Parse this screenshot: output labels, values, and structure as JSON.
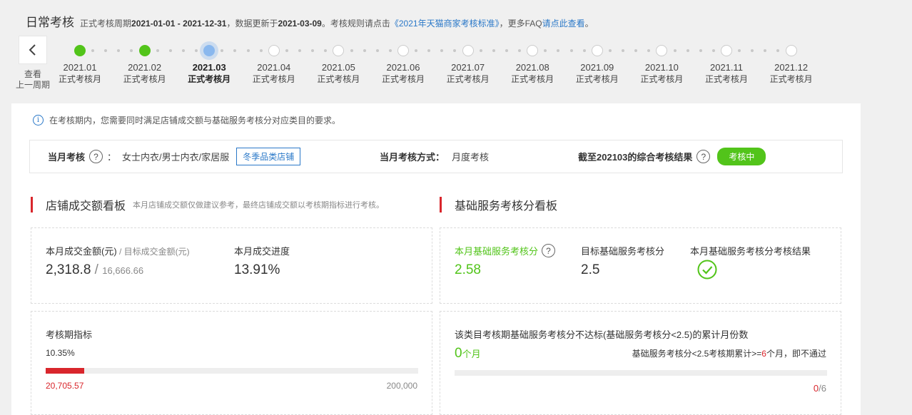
{
  "header": {
    "title": "日常考核",
    "period_prefix": "正式考核周期",
    "period_range": "2021-01-01 - 2021-12-31",
    "update_prefix": "，数据更新于",
    "update_date": "2021-03-09",
    "rule_prefix": "。考核规则请点击",
    "rule_link": "《2021年天猫商家考核标准》",
    "faq_prefix": "，更多FAQ",
    "faq_link": "请点此查看",
    "end_mark": "。"
  },
  "timeline": {
    "prev_label_1": "查看",
    "prev_label_2": "上一周期",
    "months": [
      {
        "date": "2021.01",
        "status": "正式考核月",
        "state": "done"
      },
      {
        "date": "2021.02",
        "status": "正式考核月",
        "state": "done"
      },
      {
        "date": "2021.03",
        "status": "正式考核月",
        "state": "current"
      },
      {
        "date": "2021.04",
        "status": "正式考核月",
        "state": "future"
      },
      {
        "date": "2021.05",
        "status": "正式考核月",
        "state": "future"
      },
      {
        "date": "2021.06",
        "status": "正式考核月",
        "state": "future"
      },
      {
        "date": "2021.07",
        "status": "正式考核月",
        "state": "future"
      },
      {
        "date": "2021.08",
        "status": "正式考核月",
        "state": "future"
      },
      {
        "date": "2021.09",
        "status": "正式考核月",
        "state": "future"
      },
      {
        "date": "2021.10",
        "status": "正式考核月",
        "state": "future"
      },
      {
        "date": "2021.11",
        "status": "正式考核月",
        "state": "future"
      },
      {
        "date": "2021.12",
        "status": "正式考核月",
        "state": "future"
      }
    ]
  },
  "notice": "在考核期内，您需要同时满足店铺成交额与基础服务考核分对应类目的要求。",
  "summary": {
    "month_label": "当月考核",
    "colon": "：",
    "category": "女士内衣/男士内衣/家居服",
    "tag": "冬季品类店铺",
    "method_label": "当月考核方式：",
    "method_value": "月度考核",
    "result_label": "截至202103的综合考核结果",
    "result_status": "考核中"
  },
  "sales": {
    "title": "店铺成交额看板",
    "subtitle": "本月店铺成交额仅做建议参考，最终店铺成交额以考核期指标进行考核。",
    "amount_label": "本月成交金额(元)",
    "target_label": " / 目标成交金额(元)",
    "amount_value": "2,318.8",
    "slash": " / ",
    "target_value": "16,666.66",
    "progress_label": "本月成交进度",
    "progress_value": "13.91%",
    "period_label": "考核期指标",
    "period_pct": "10.35%",
    "period_fraction": 0.1035,
    "period_current": "20,705.57",
    "period_target": "200,000"
  },
  "service": {
    "title": "基础服务考核分看板",
    "score_label": "本月基础服务考核分",
    "score_value": "2.58",
    "target_label": "目标基础服务考核分",
    "target_value": "2.5",
    "result_label": "本月基础服务考核分考核结果",
    "fail_title": "该类目考核期基础服务考核分不达标(基础服务考核分<2.5)的累计月份数",
    "fail_count": "0",
    "fail_unit": "个月",
    "rule_prefix": "基础服务考核分<2.5考核期累计>=",
    "rule_count": "6",
    "rule_suffix": "个月，即不通过",
    "fraction_num": "0",
    "fraction_den": "/6",
    "fail_fraction": 0
  },
  "colors": {
    "accent_blue": "#2a78c8",
    "green": "#52c41a",
    "red": "#d9262c"
  }
}
